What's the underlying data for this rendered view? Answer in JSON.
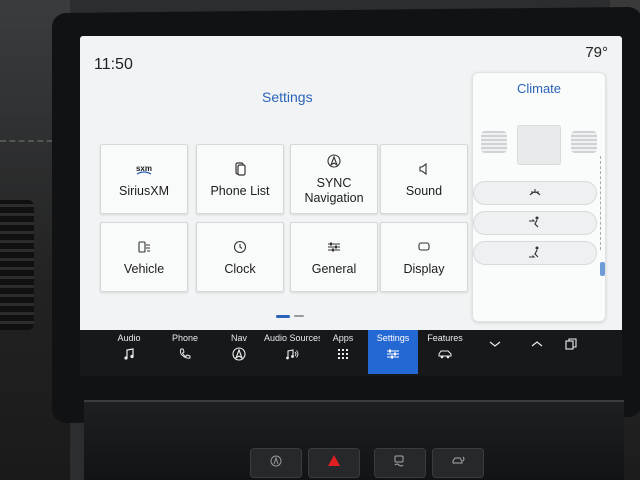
{
  "status": {
    "time": "11:50",
    "temperature": "79°"
  },
  "settings": {
    "title": "Settings",
    "tiles": [
      {
        "label": "SiriusXM",
        "icon": "sxm-icon"
      },
      {
        "label": "Phone List",
        "icon": "phone-list-icon"
      },
      {
        "label": "SYNC\nNavigation",
        "icon": "navigation-icon"
      },
      {
        "label": "Sound",
        "icon": "speaker-icon"
      },
      {
        "label": "Vehicle",
        "icon": "vehicle-icon"
      },
      {
        "label": "Clock",
        "icon": "clock-icon"
      },
      {
        "label": "General",
        "icon": "sliders-icon"
      },
      {
        "label": "Display",
        "icon": "display-icon"
      }
    ],
    "sxm_logo_text": "sxm"
  },
  "climate": {
    "title": "Climate",
    "buttons": [
      {
        "icon": "defrost-icon"
      },
      {
        "icon": "airflow-face-icon"
      },
      {
        "icon": "airflow-feet-icon"
      }
    ]
  },
  "navbar": {
    "items": [
      {
        "label": "Audio",
        "icon": "music-note-icon"
      },
      {
        "label": "Phone",
        "icon": "phone-icon"
      },
      {
        "label": "Nav",
        "icon": "navigation-icon"
      },
      {
        "label": "Audio Sources",
        "icon": "audio-sources-icon"
      },
      {
        "label": "Apps",
        "icon": "apps-grid-icon"
      },
      {
        "label": "Settings",
        "icon": "sliders-icon",
        "active": true
      },
      {
        "label": "Features",
        "icon": "car-icon"
      },
      {
        "label": "",
        "icon": "chevron-down-icon"
      },
      {
        "label": "",
        "icon": "chevron-up-icon"
      },
      {
        "label": "",
        "icon": "windows-icon"
      }
    ],
    "active_color": "#2468d4"
  },
  "colors": {
    "accent": "#2a63b8",
    "hazard": "#e02020"
  }
}
